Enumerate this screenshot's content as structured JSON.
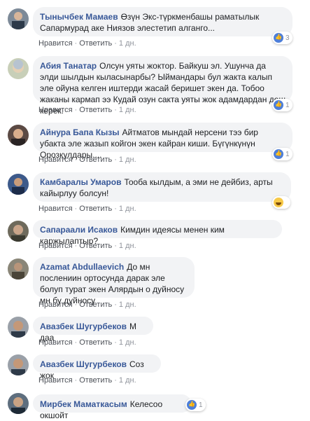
{
  "actions": {
    "like": "Нравится",
    "reply": "Ответить",
    "sep": "·",
    "time": "1 дн."
  },
  "comments": [
    {
      "author": "Тынычбек Мамаев",
      "text": "Өзүн Экс-түркменбашы раматылык Сапармурад аке Ниязов элестетип алганго...",
      "reaction": "like",
      "reaction_count": "3"
    },
    {
      "author": "Абия Танатар",
      "text": "Олсун уяты жоктор. Байкуш эл. Ушунча да элди шылдын кыласынарбы? Ыймандары бул жакта калып эле ойуна келген иштерди жасай беришет экен да. Тобоо жаканы кармап ээ Кудай озун сакта уяты жок адамдардан деш керек.",
      "reaction": "like",
      "reaction_count": "1"
    },
    {
      "author": "Айнура Бапа Кызы",
      "text": "Айтматов мындай нерсени тээ бир убакта эле жазып койгон экен кайран киши. Бүгүнкүнүн Орозкулдары....",
      "reaction": "like",
      "reaction_count": "1"
    },
    {
      "author": "Камбаралы Умаров",
      "text": "Тооба кылдым, а эми не дейбиз, арты кайырлуу болсун!",
      "reaction": "haha",
      "reaction_count": ""
    },
    {
      "author": "Сапараали Исаков",
      "text": "Кимдин идеясы менен ким каржылаптыр?",
      "reaction": "",
      "reaction_count": ""
    },
    {
      "author": "Azamat Abdullaevich",
      "text": "До мн послениин ортосунда дарак эле болуп турат экен Алярдын о дуйносу мн бу дуйносу",
      "reaction": "",
      "reaction_count": ""
    },
    {
      "author": "Авазбек Шугурбеков",
      "text": "М даа",
      "reaction": "",
      "reaction_count": ""
    },
    {
      "author": "Авазбек Шугурбеков",
      "text": "Соз жок",
      "reaction": "",
      "reaction_count": ""
    },
    {
      "author": "Мирбек Маматкасым",
      "text": "Келесоо окшойт",
      "reaction": "like",
      "reaction_count": "1"
    }
  ]
}
